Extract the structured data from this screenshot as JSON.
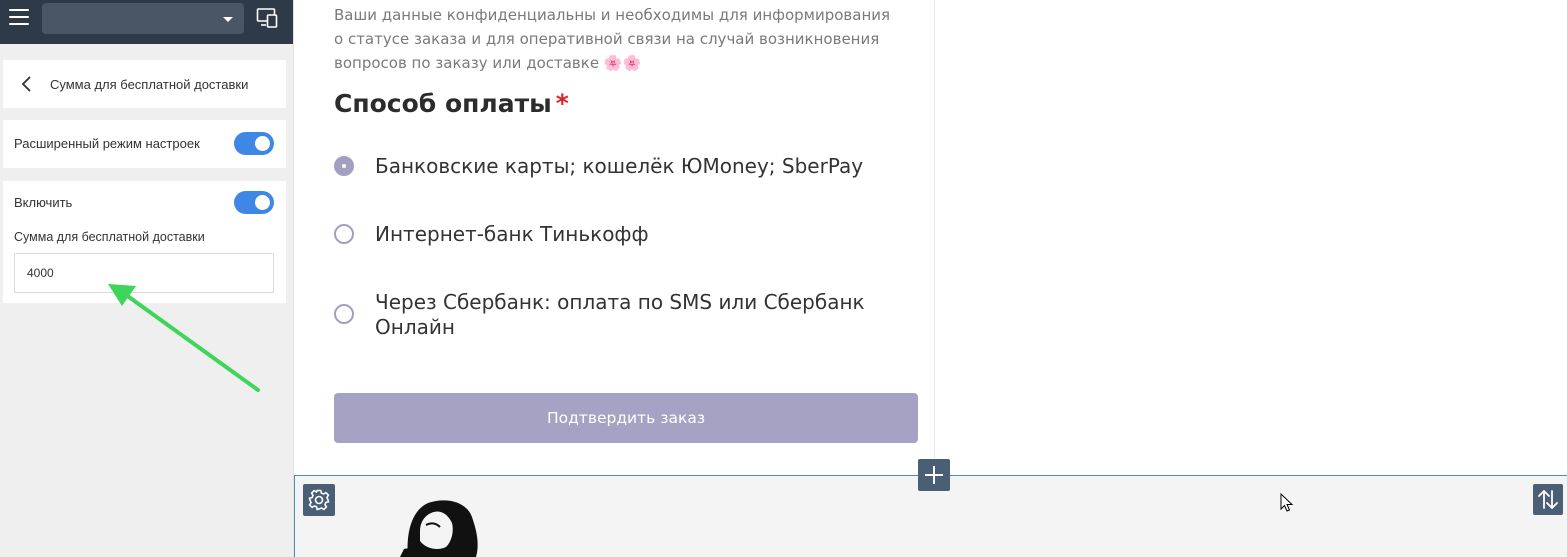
{
  "topbar": {
    "menu_icon": "hamburger-icon",
    "site_select_value": "",
    "preview_icon": "device-preview-icon"
  },
  "panel": {
    "back_icon": "chevron-left-icon",
    "title": "Сумма для бесплатной доставки",
    "advanced_label": "Расширенный режим настроек",
    "advanced_on": true,
    "enable_label": "Включить",
    "enable_on": true,
    "amount_label": "Сумма для бесплатной доставки",
    "amount_value": "4000"
  },
  "content": {
    "privacy_text": "Ваши данные конфиденциальны и необходимы для информирования о статусе заказа и для оперативной связи на случай возникновения вопросов по заказу или доставке 🌸🌸",
    "section_title": "Способ оплаты",
    "required_mark": "*",
    "payment_options": [
      {
        "label": "Банковские карты; кошелёк ЮMoney; SberPay",
        "selected": true
      },
      {
        "label": "Интернет-банк Тинькофф",
        "selected": false
      },
      {
        "label": "Через Сбербанк: оплата по SMS или Сбербанк Онлайн",
        "selected": false
      }
    ],
    "confirm_button": "Подтвердить заказ"
  },
  "block_controls": {
    "add_icon": "plus-icon",
    "settings_icon": "gear-icon",
    "reorder_icon": "sort-arrows-icon"
  },
  "colors": {
    "topbar": "#2e3a48",
    "toggle_on": "#3f87e5",
    "radio": "#a29fc1",
    "confirm_button": "#a6a2c4",
    "required": "#e02020",
    "annotation_arrow": "#3fd45a"
  }
}
